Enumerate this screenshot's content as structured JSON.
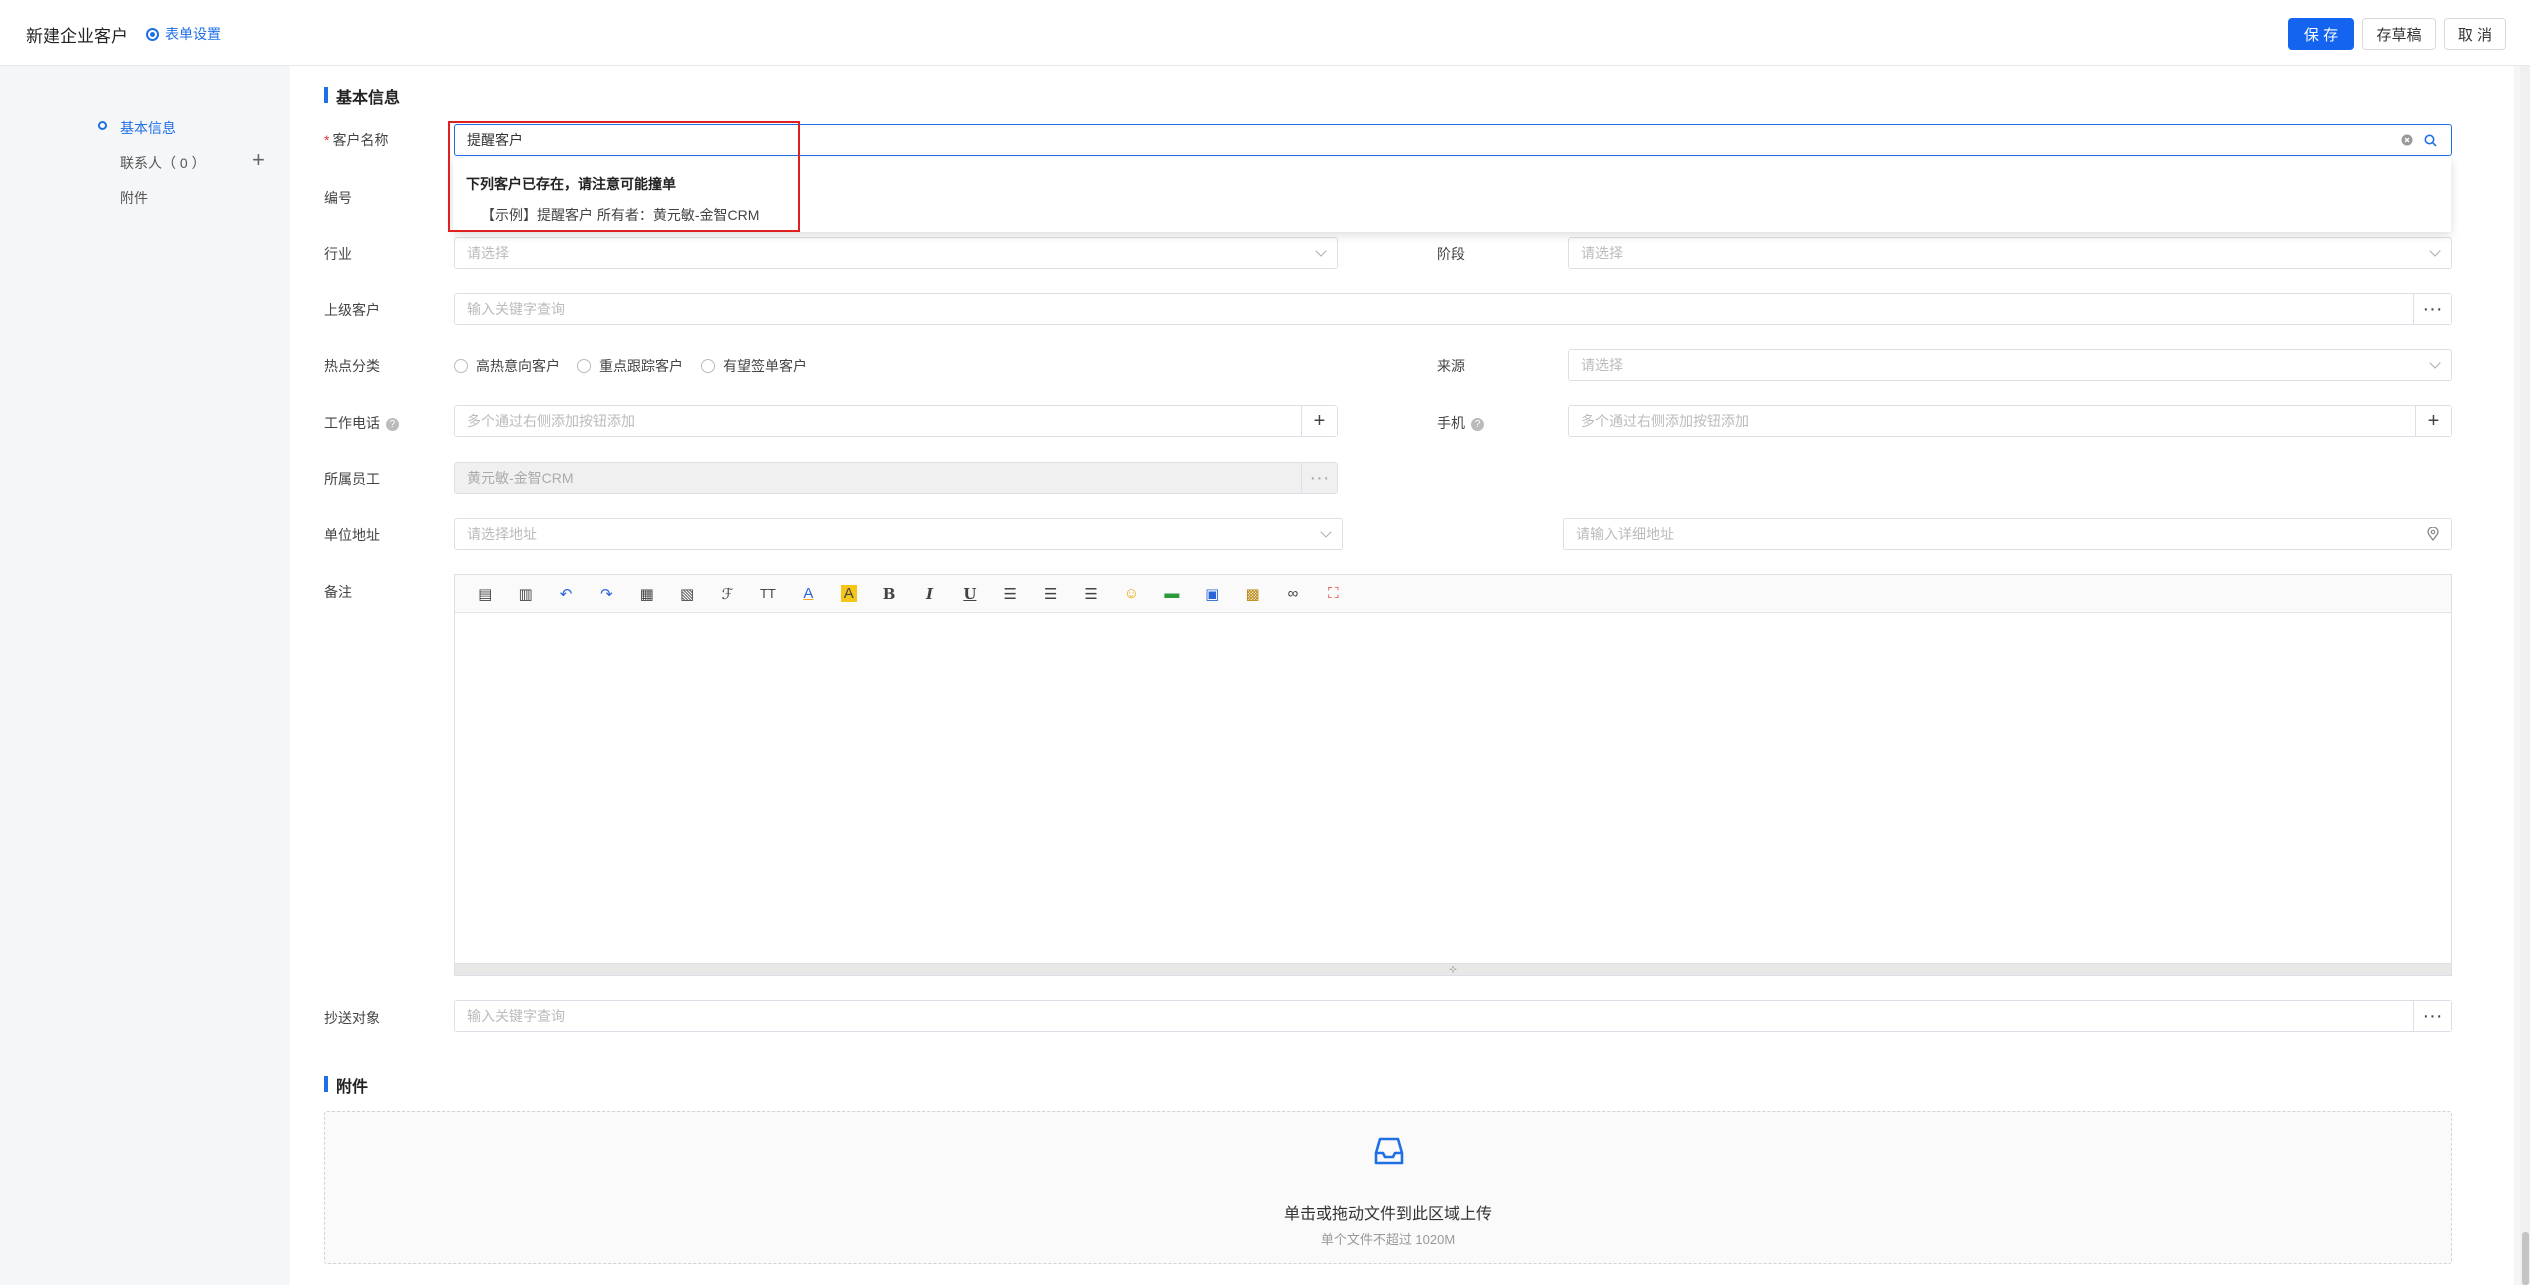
{
  "header": {
    "title": "新建企业客户",
    "form_settings": "表单设置",
    "save": "保 存",
    "draft": "存草稿",
    "cancel": "取 消"
  },
  "sidebar": {
    "items": [
      {
        "label": "基本信息",
        "active": true
      },
      {
        "label": "联系人（ 0 ）",
        "active": false
      },
      {
        "label": "附件",
        "active": false
      }
    ],
    "add_icon": "plus-icon"
  },
  "sections": {
    "basic": "基本信息",
    "attachments": "附件"
  },
  "form": {
    "customer_name": {
      "label": "客户名称",
      "value": "提醒客户"
    },
    "code": {
      "label": "编号"
    },
    "industry": {
      "label": "行业",
      "placeholder": "请选择"
    },
    "stage": {
      "label": "阶段",
      "placeholder": "请选择"
    },
    "parent_customer": {
      "label": "上级客户",
      "placeholder": "输入关键字查询"
    },
    "hot_category": {
      "label": "热点分类",
      "options": [
        "高热意向客户",
        "重点跟踪客户",
        "有望签单客户"
      ]
    },
    "source": {
      "label": "来源",
      "placeholder": "请选择"
    },
    "work_phone": {
      "label": "工作电话",
      "placeholder": "多个通过右侧添加按钮添加"
    },
    "mobile": {
      "label": "手机",
      "placeholder": "多个通过右侧添加按钮添加"
    },
    "owner": {
      "label": "所属员工",
      "value": "黄元敏-金智CRM"
    },
    "address": {
      "label": "单位地址",
      "placeholder": "请选择地址",
      "detail_placeholder": "请输入详细地址"
    },
    "remark": {
      "label": "备注"
    },
    "cc": {
      "label": "抄送对象",
      "placeholder": "输入关键字查询"
    }
  },
  "duplicate_dropdown": {
    "warning": "下列客户已存在，请注意可能撞单",
    "item": "【示例】提醒客户   所有者：黄元敏-金智CRM"
  },
  "upload": {
    "text": "单击或拖动文件到此区域上传",
    "hint": "单个文件不超过 1020M"
  },
  "colors": {
    "accent": "#1f6fe5",
    "required": "#e33333",
    "highlight_box": "#e02020"
  }
}
